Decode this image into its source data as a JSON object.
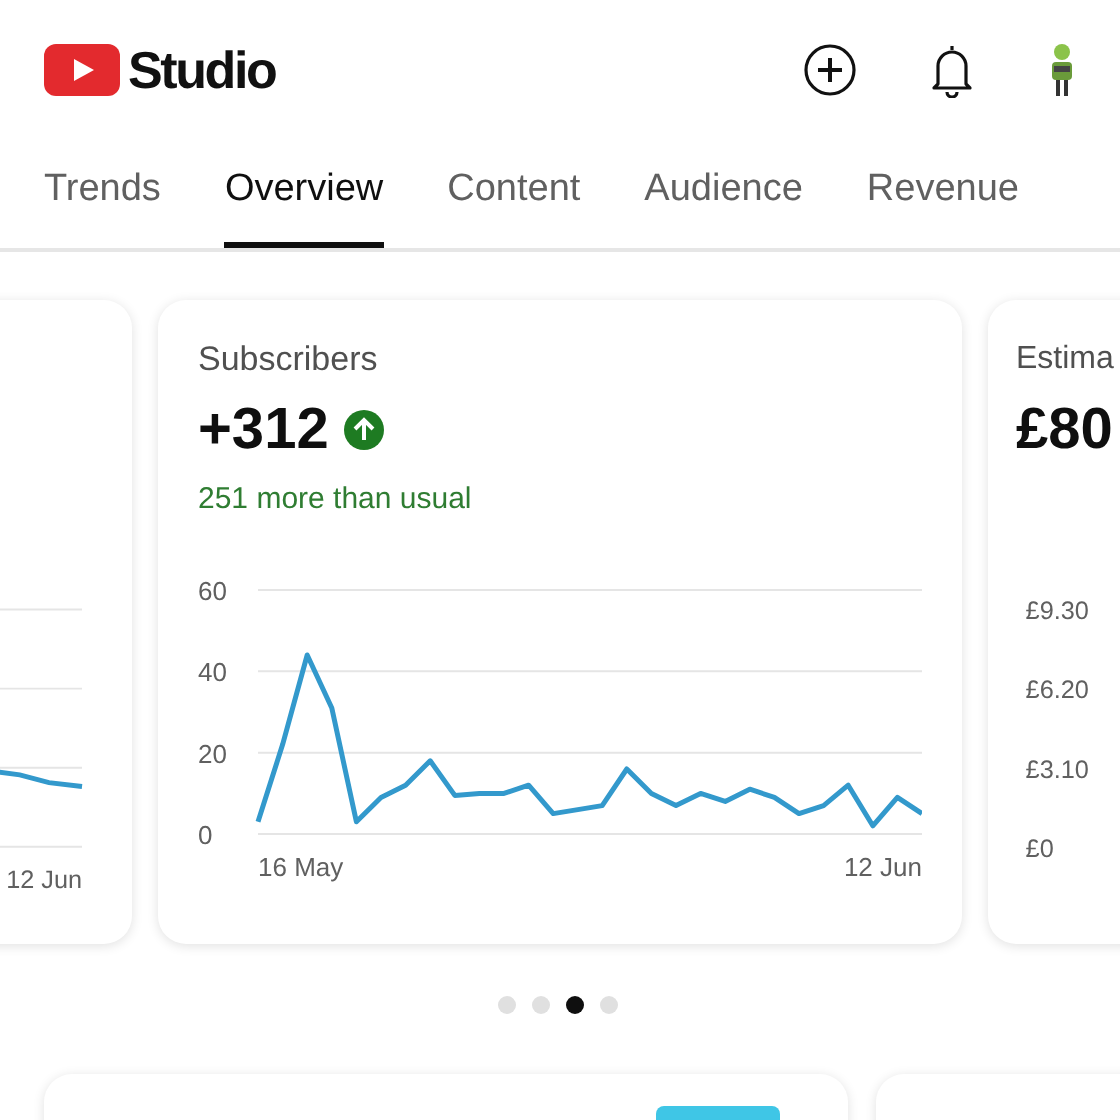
{
  "header": {
    "logo_text": "Studio"
  },
  "tabs": [
    {
      "label": "Trends",
      "selected": false
    },
    {
      "label": "Overview",
      "selected": true
    },
    {
      "label": "Content",
      "selected": false
    },
    {
      "label": "Audience",
      "selected": false
    },
    {
      "label": "Revenue",
      "selected": false
    }
  ],
  "cards": [
    {
      "kind": "partial-left",
      "x_label_end": "12 Jun"
    },
    {
      "kind": "full",
      "title": "Subscribers",
      "value": "+312",
      "trend_up": true,
      "note": "251 more than usual",
      "x_labels": [
        "16 May",
        "12 Jun"
      ],
      "chart_data": {
        "type": "line",
        "yticks": [
          0,
          20,
          40,
          60
        ],
        "ylim": [
          0,
          60
        ],
        "series": [
          {
            "color": "#3399cc",
            "values": [
              3,
              22,
              44,
              31,
              3,
              9,
              12,
              18,
              9.5,
              10,
              10,
              12,
              5,
              6,
              7,
              16,
              10,
              7,
              10,
              8,
              11,
              9,
              5,
              7,
              12,
              2,
              9,
              5
            ]
          }
        ]
      }
    },
    {
      "kind": "partial-right",
      "title": "Estima",
      "value": "£80",
      "y_labels": [
        "£9.30",
        "£6.20",
        "£3.10",
        "£0"
      ]
    }
  ],
  "pager": [
    {
      "selected": false
    },
    {
      "selected": false
    },
    {
      "selected": true
    },
    {
      "selected": false
    }
  ]
}
